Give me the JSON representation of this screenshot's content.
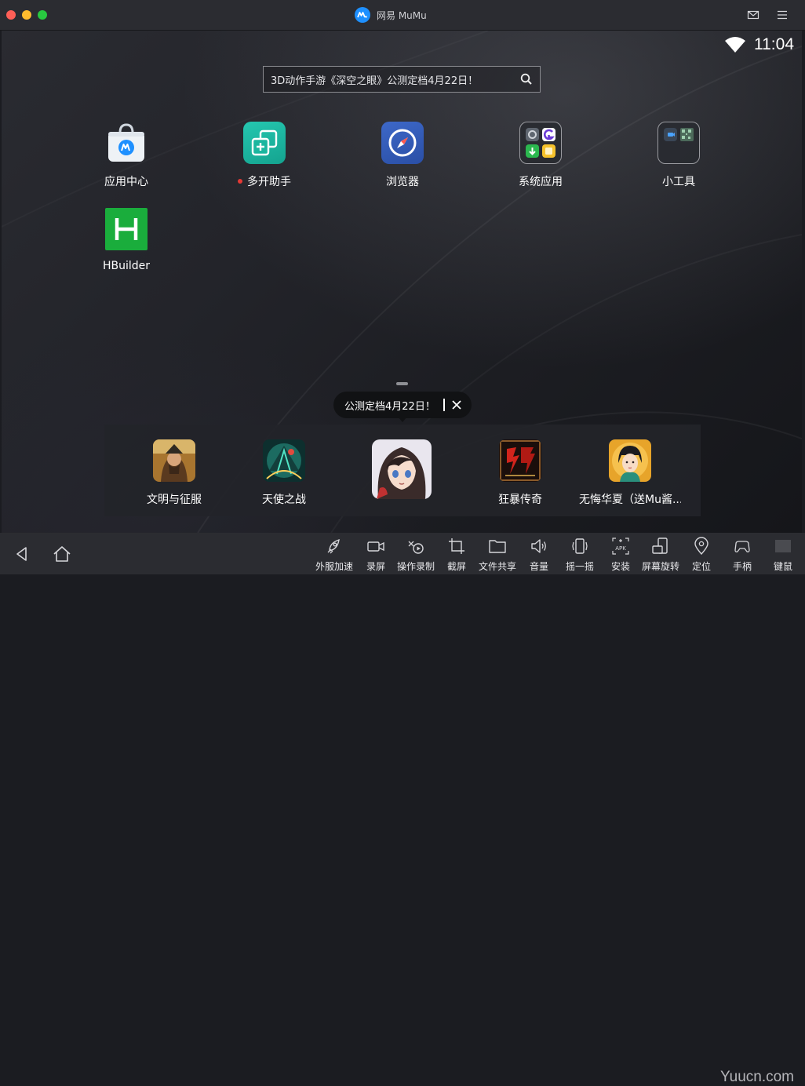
{
  "window": {
    "title": "网易 MuMu"
  },
  "status": {
    "time": "11:04"
  },
  "search": {
    "text": "3D动作手游《深空之眼》公测定档4月22日！"
  },
  "home_apps": [
    {
      "label": "应用中心"
    },
    {
      "label": "多开助手",
      "badge": true
    },
    {
      "label": "浏览器"
    },
    {
      "label": "系统应用"
    },
    {
      "label": "小工具"
    },
    {
      "label": "HBuilder"
    }
  ],
  "tooltip": {
    "text": "公测定档4月22日！"
  },
  "dock_apps": [
    {
      "label": "文明与征服"
    },
    {
      "label": "天使之战"
    },
    {
      "label": ""
    },
    {
      "label": "狂暴传奇"
    },
    {
      "label": "无悔华夏（送Mu酱..."
    }
  ],
  "toolbar": [
    {
      "label": "外服加速",
      "icon": "rocket-icon"
    },
    {
      "label": "录屏",
      "icon": "video-camera-icon"
    },
    {
      "label": "操作录制",
      "icon": "macro-record-icon"
    },
    {
      "label": "截屏",
      "icon": "crop-icon"
    },
    {
      "label": "文件共享",
      "icon": "folder-icon"
    },
    {
      "label": "音量",
      "icon": "speaker-icon"
    },
    {
      "label": "摇一摇",
      "icon": "shake-phone-icon"
    },
    {
      "label": "安装",
      "icon": "apk-install-icon"
    },
    {
      "label": "屏幕旋转",
      "icon": "rotate-screen-icon"
    },
    {
      "label": "定位",
      "icon": "location-pin-icon"
    },
    {
      "label": "手柄",
      "icon": "gamepad-icon"
    },
    {
      "label": "键鼠",
      "icon": "keyboard-mouse-icon"
    }
  ],
  "watermark": {
    "text": "Yuucn.com"
  },
  "colors": {
    "accent": "#1e90ff",
    "dot_red": "#e53935",
    "hbuilder_green": "#1aad3c"
  }
}
